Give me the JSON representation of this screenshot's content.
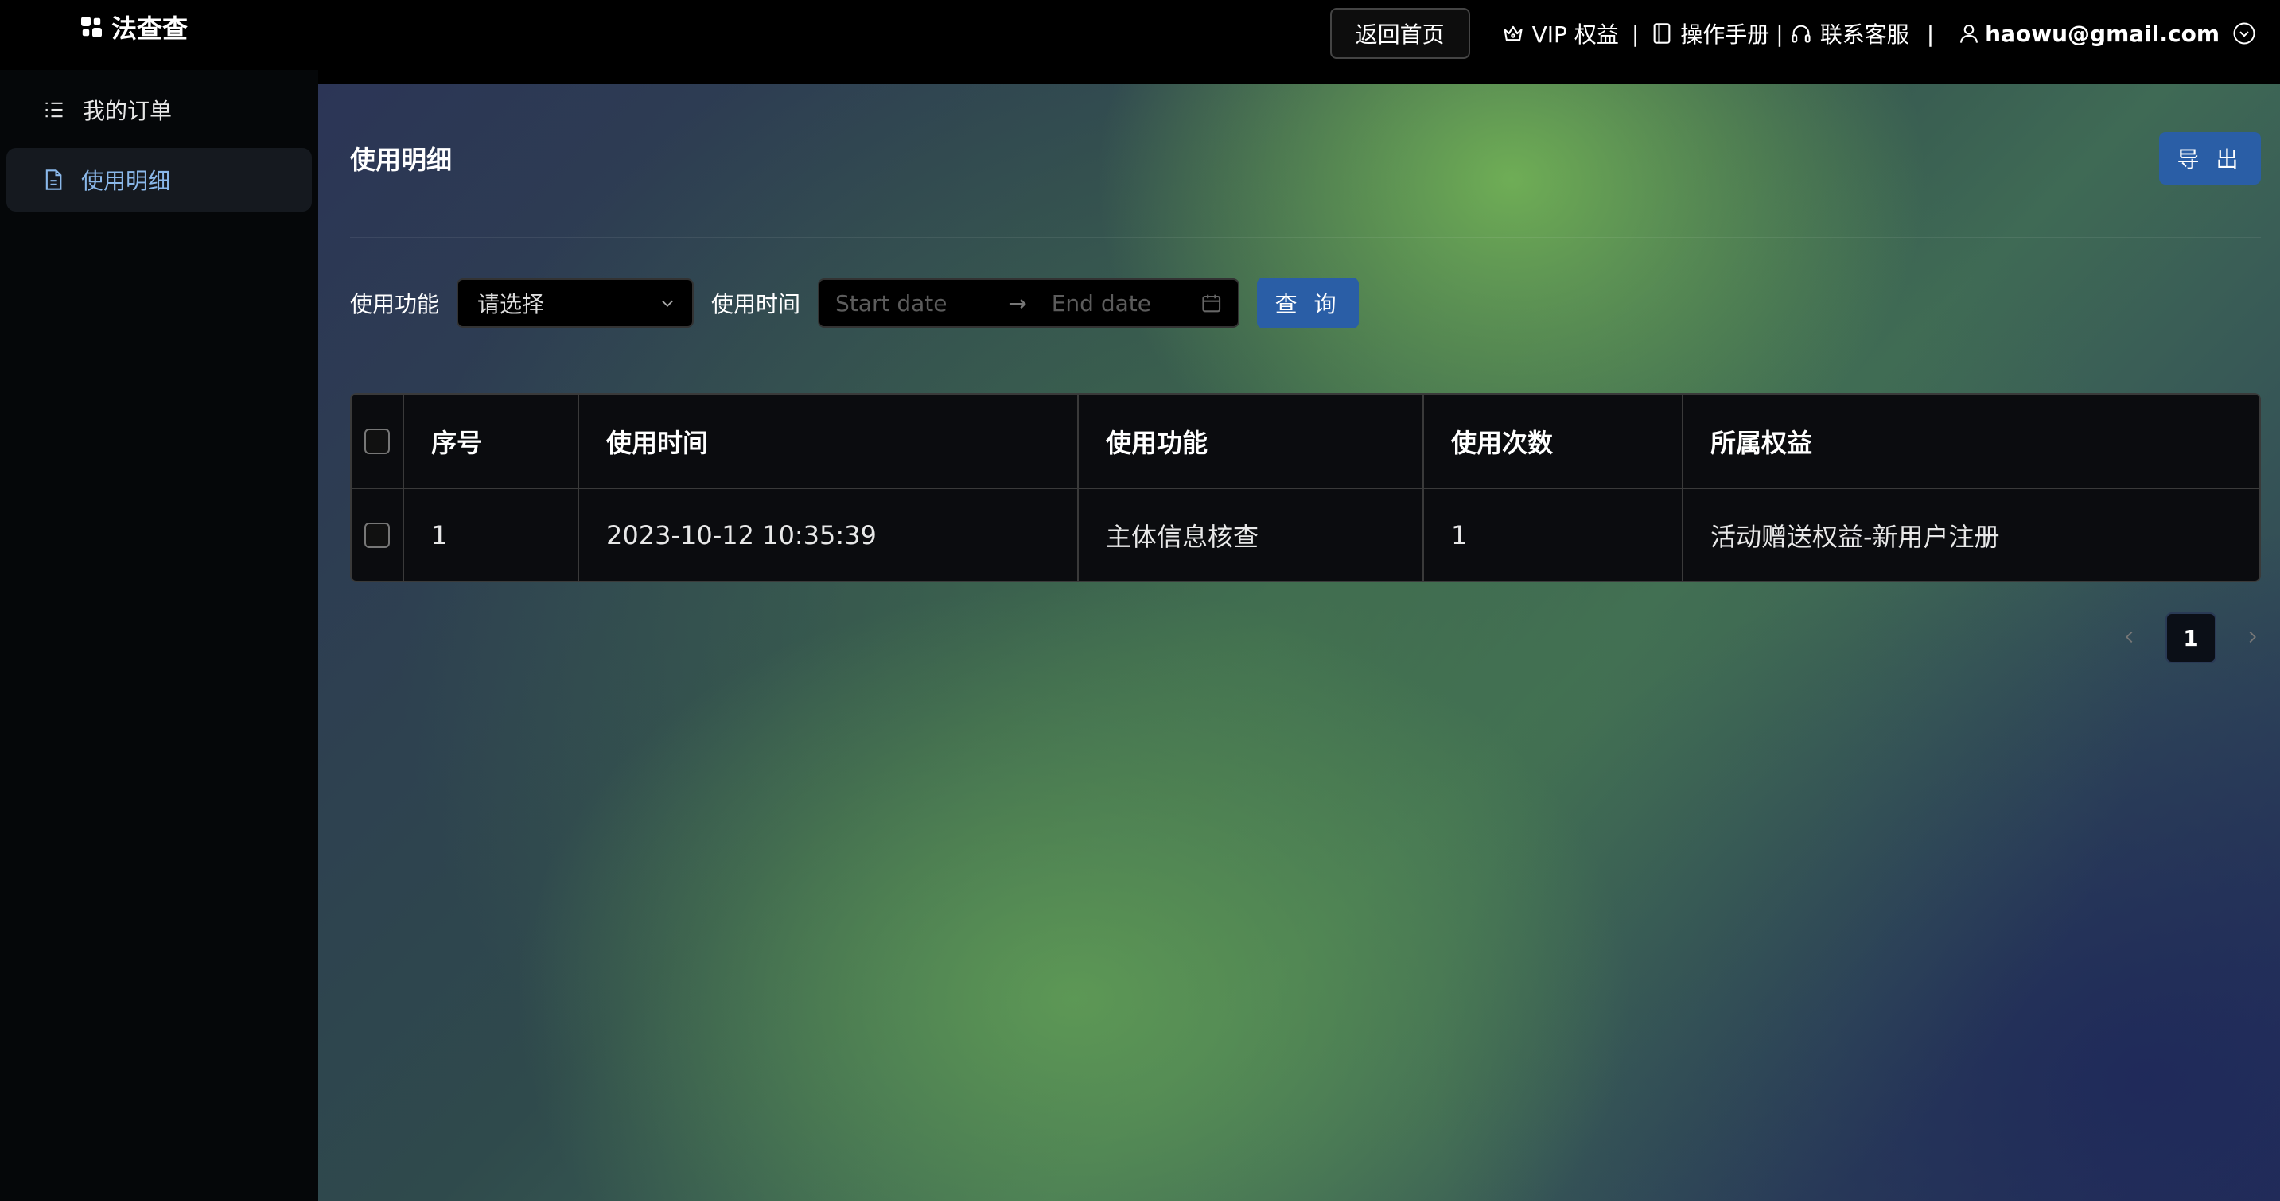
{
  "app": {
    "title": "法查查"
  },
  "header": {
    "home_button": "返回首页",
    "vip_label": "VIP 权益",
    "separator": "|",
    "manual_label": "操作手册",
    "service_label": "联系客服",
    "user_email": "haowu@gmail.com"
  },
  "sidebar": {
    "items": [
      {
        "label": "我的订单",
        "icon": "list-icon",
        "active": false
      },
      {
        "label": "使用明细",
        "icon": "document-icon",
        "active": true
      }
    ]
  },
  "main": {
    "title": "使用明细",
    "export_button": "导 出",
    "filters": {
      "feature_label": "使用功能",
      "feature_value": "请选择",
      "time_label": "使用时间",
      "start_placeholder": "Start date",
      "end_placeholder": "End date",
      "query_button": "查 询"
    },
    "table": {
      "columns": [
        "序号",
        "使用时间",
        "使用功能",
        "使用次数",
        "所属权益"
      ],
      "rows": [
        [
          "1",
          "2023-10-12 10:35:39",
          "主体信息核查",
          "1",
          "活动赠送权益-新用户注册"
        ]
      ]
    },
    "pagination": {
      "current_page": "1"
    }
  },
  "colors": {
    "accent": "#2a5ea6",
    "active_text": "#8ab8ea",
    "background": "#000000"
  }
}
